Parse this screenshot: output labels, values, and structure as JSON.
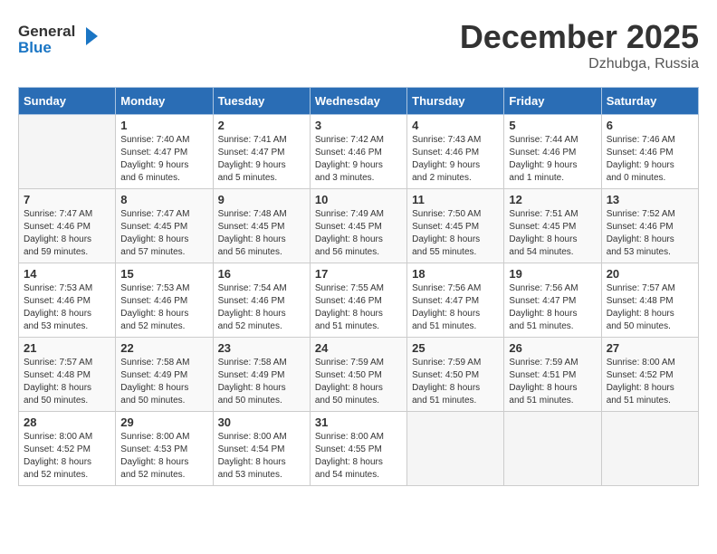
{
  "header": {
    "logo_line1": "General",
    "logo_line2": "Blue",
    "month": "December 2025",
    "location": "Dzhubga, Russia"
  },
  "weekdays": [
    "Sunday",
    "Monday",
    "Tuesday",
    "Wednesday",
    "Thursday",
    "Friday",
    "Saturday"
  ],
  "weeks": [
    [
      {
        "day": "",
        "info": ""
      },
      {
        "day": "1",
        "info": "Sunrise: 7:40 AM\nSunset: 4:47 PM\nDaylight: 9 hours\nand 6 minutes."
      },
      {
        "day": "2",
        "info": "Sunrise: 7:41 AM\nSunset: 4:47 PM\nDaylight: 9 hours\nand 5 minutes."
      },
      {
        "day": "3",
        "info": "Sunrise: 7:42 AM\nSunset: 4:46 PM\nDaylight: 9 hours\nand 3 minutes."
      },
      {
        "day": "4",
        "info": "Sunrise: 7:43 AM\nSunset: 4:46 PM\nDaylight: 9 hours\nand 2 minutes."
      },
      {
        "day": "5",
        "info": "Sunrise: 7:44 AM\nSunset: 4:46 PM\nDaylight: 9 hours\nand 1 minute."
      },
      {
        "day": "6",
        "info": "Sunrise: 7:46 AM\nSunset: 4:46 PM\nDaylight: 9 hours\nand 0 minutes."
      }
    ],
    [
      {
        "day": "7",
        "info": "Sunrise: 7:47 AM\nSunset: 4:46 PM\nDaylight: 8 hours\nand 59 minutes."
      },
      {
        "day": "8",
        "info": "Sunrise: 7:47 AM\nSunset: 4:45 PM\nDaylight: 8 hours\nand 57 minutes."
      },
      {
        "day": "9",
        "info": "Sunrise: 7:48 AM\nSunset: 4:45 PM\nDaylight: 8 hours\nand 56 minutes."
      },
      {
        "day": "10",
        "info": "Sunrise: 7:49 AM\nSunset: 4:45 PM\nDaylight: 8 hours\nand 56 minutes."
      },
      {
        "day": "11",
        "info": "Sunrise: 7:50 AM\nSunset: 4:45 PM\nDaylight: 8 hours\nand 55 minutes."
      },
      {
        "day": "12",
        "info": "Sunrise: 7:51 AM\nSunset: 4:45 PM\nDaylight: 8 hours\nand 54 minutes."
      },
      {
        "day": "13",
        "info": "Sunrise: 7:52 AM\nSunset: 4:46 PM\nDaylight: 8 hours\nand 53 minutes."
      }
    ],
    [
      {
        "day": "14",
        "info": "Sunrise: 7:53 AM\nSunset: 4:46 PM\nDaylight: 8 hours\nand 53 minutes."
      },
      {
        "day": "15",
        "info": "Sunrise: 7:53 AM\nSunset: 4:46 PM\nDaylight: 8 hours\nand 52 minutes."
      },
      {
        "day": "16",
        "info": "Sunrise: 7:54 AM\nSunset: 4:46 PM\nDaylight: 8 hours\nand 52 minutes."
      },
      {
        "day": "17",
        "info": "Sunrise: 7:55 AM\nSunset: 4:46 PM\nDaylight: 8 hours\nand 51 minutes."
      },
      {
        "day": "18",
        "info": "Sunrise: 7:56 AM\nSunset: 4:47 PM\nDaylight: 8 hours\nand 51 minutes."
      },
      {
        "day": "19",
        "info": "Sunrise: 7:56 AM\nSunset: 4:47 PM\nDaylight: 8 hours\nand 51 minutes."
      },
      {
        "day": "20",
        "info": "Sunrise: 7:57 AM\nSunset: 4:48 PM\nDaylight: 8 hours\nand 50 minutes."
      }
    ],
    [
      {
        "day": "21",
        "info": "Sunrise: 7:57 AM\nSunset: 4:48 PM\nDaylight: 8 hours\nand 50 minutes."
      },
      {
        "day": "22",
        "info": "Sunrise: 7:58 AM\nSunset: 4:49 PM\nDaylight: 8 hours\nand 50 minutes."
      },
      {
        "day": "23",
        "info": "Sunrise: 7:58 AM\nSunset: 4:49 PM\nDaylight: 8 hours\nand 50 minutes."
      },
      {
        "day": "24",
        "info": "Sunrise: 7:59 AM\nSunset: 4:50 PM\nDaylight: 8 hours\nand 50 minutes."
      },
      {
        "day": "25",
        "info": "Sunrise: 7:59 AM\nSunset: 4:50 PM\nDaylight: 8 hours\nand 51 minutes."
      },
      {
        "day": "26",
        "info": "Sunrise: 7:59 AM\nSunset: 4:51 PM\nDaylight: 8 hours\nand 51 minutes."
      },
      {
        "day": "27",
        "info": "Sunrise: 8:00 AM\nSunset: 4:52 PM\nDaylight: 8 hours\nand 51 minutes."
      }
    ],
    [
      {
        "day": "28",
        "info": "Sunrise: 8:00 AM\nSunset: 4:52 PM\nDaylight: 8 hours\nand 52 minutes."
      },
      {
        "day": "29",
        "info": "Sunrise: 8:00 AM\nSunset: 4:53 PM\nDaylight: 8 hours\nand 52 minutes."
      },
      {
        "day": "30",
        "info": "Sunrise: 8:00 AM\nSunset: 4:54 PM\nDaylight: 8 hours\nand 53 minutes."
      },
      {
        "day": "31",
        "info": "Sunrise: 8:00 AM\nSunset: 4:55 PM\nDaylight: 8 hours\nand 54 minutes."
      },
      {
        "day": "",
        "info": ""
      },
      {
        "day": "",
        "info": ""
      },
      {
        "day": "",
        "info": ""
      }
    ]
  ]
}
